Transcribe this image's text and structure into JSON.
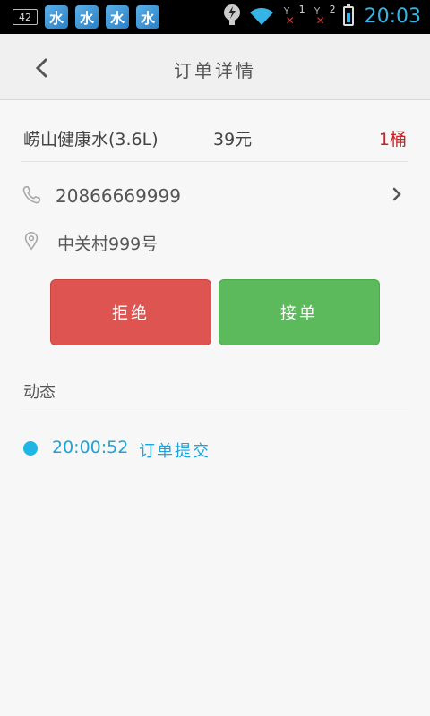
{
  "status_bar": {
    "notification_count": "42",
    "app_icons": [
      "水",
      "水",
      "水",
      "水"
    ],
    "sim1": "1",
    "sim2": "2",
    "time": "20:03"
  },
  "header": {
    "title": "订单详情",
    "back_icon": "chevron-left-icon"
  },
  "order": {
    "product_name": "崂山健康水(3.6L)",
    "price": "39元",
    "quantity": "1桶"
  },
  "customer": {
    "phone": "20866669999",
    "address": "中关村999号"
  },
  "actions": {
    "reject_label": "拒绝",
    "accept_label": "接单"
  },
  "activity": {
    "title": "动态",
    "events": [
      {
        "time": "20:00:52",
        "text": "订单提交"
      }
    ]
  },
  "colors": {
    "reject": "#dd5450",
    "accept": "#5cba5c",
    "accent": "#1fa3d8",
    "quantity": "#cc2222"
  }
}
